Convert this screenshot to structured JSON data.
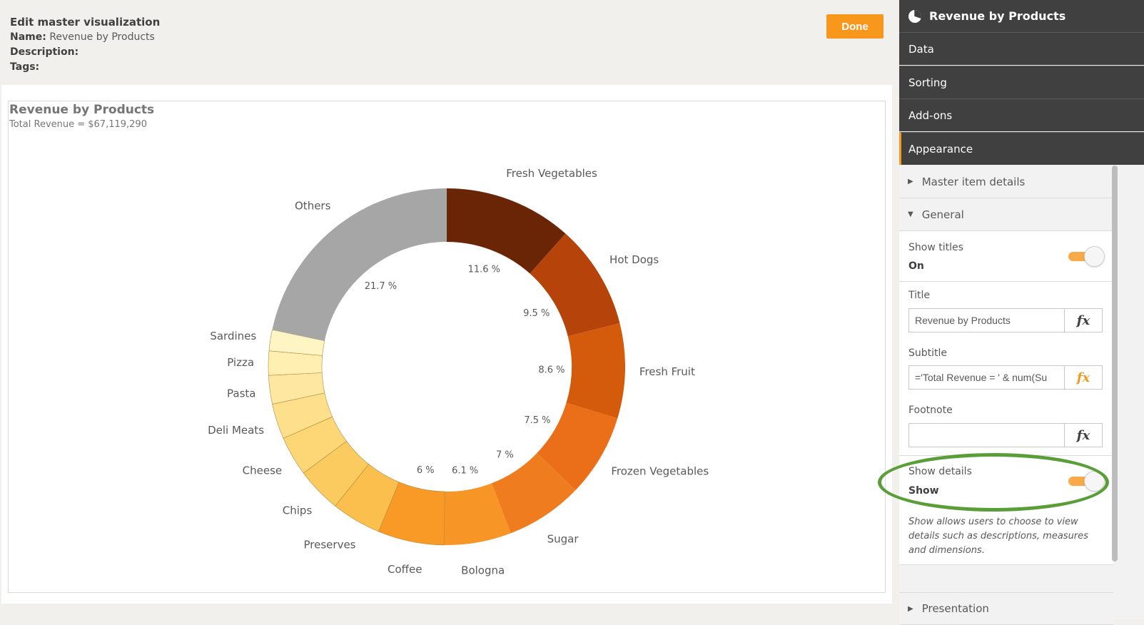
{
  "header": {
    "title": "Edit master visualization",
    "name_label": "Name:",
    "name_value": "Revenue by Products",
    "description_label": "Description:",
    "tags_label": "Tags:",
    "done_label": "Done"
  },
  "visualization": {
    "title": "Revenue by Products",
    "subtitle": "Total Revenue = $67,119,290"
  },
  "chart_data": {
    "type": "pie",
    "variant": "donut",
    "title": "Revenue by Products",
    "subtitle": "Total Revenue = $67,119,290",
    "categories": [
      "Fresh Vegetables",
      "Hot Dogs",
      "Fresh Fruit",
      "Frozen Vegetables",
      "Sugar",
      "Bologna",
      "Coffee",
      "Preserves",
      "Chips",
      "Cheese",
      "Deli Meats",
      "Pasta",
      "Pizza",
      "Sardines",
      "Others"
    ],
    "values": [
      11.6,
      9.5,
      8.6,
      7.5,
      7.0,
      6.1,
      6.0,
      4.5,
      4.1,
      3.6,
      3.2,
      2.6,
      2.2,
      1.9,
      21.7
    ],
    "value_labels": [
      "11.6 %",
      "9.5 %",
      "8.6 %",
      "7.5 %",
      "7 %",
      "6.1 %",
      "6 %",
      "",
      "",
      "",
      "",
      "",
      "",
      "",
      "21.7 %"
    ],
    "colors": [
      "#692505",
      "#b5430a",
      "#d45a0c",
      "#ea6f18",
      "#ef7d1f",
      "#f79526",
      "#f99a26",
      "#fbbf4e",
      "#fccb60",
      "#fdd676",
      "#fee08c",
      "#fee8a1",
      "#ffefb1",
      "#fff5c4",
      "#a6a6a6"
    ],
    "unit": "%"
  },
  "panel": {
    "header_title": "Revenue by Products",
    "nav": [
      "Data",
      "Sorting",
      "Add-ons",
      "Appearance"
    ],
    "active_nav": "Appearance",
    "sections": {
      "master_item_details": "Master item details",
      "general": "General",
      "presentation": "Presentation"
    },
    "show_titles": {
      "label": "Show titles",
      "value": "On",
      "on": true
    },
    "title_field": {
      "label": "Title",
      "value": "Revenue by Products"
    },
    "subtitle_field": {
      "label": "Subtitle",
      "value": "='Total Revenue = ' & num(Su"
    },
    "footnote_field": {
      "label": "Footnote",
      "value": ""
    },
    "fx_label": "fx",
    "show_details": {
      "label": "Show details",
      "value": "Show",
      "on": true
    },
    "help_text": "Show allows users to choose to view details such as descriptions, measures and dimensions."
  }
}
